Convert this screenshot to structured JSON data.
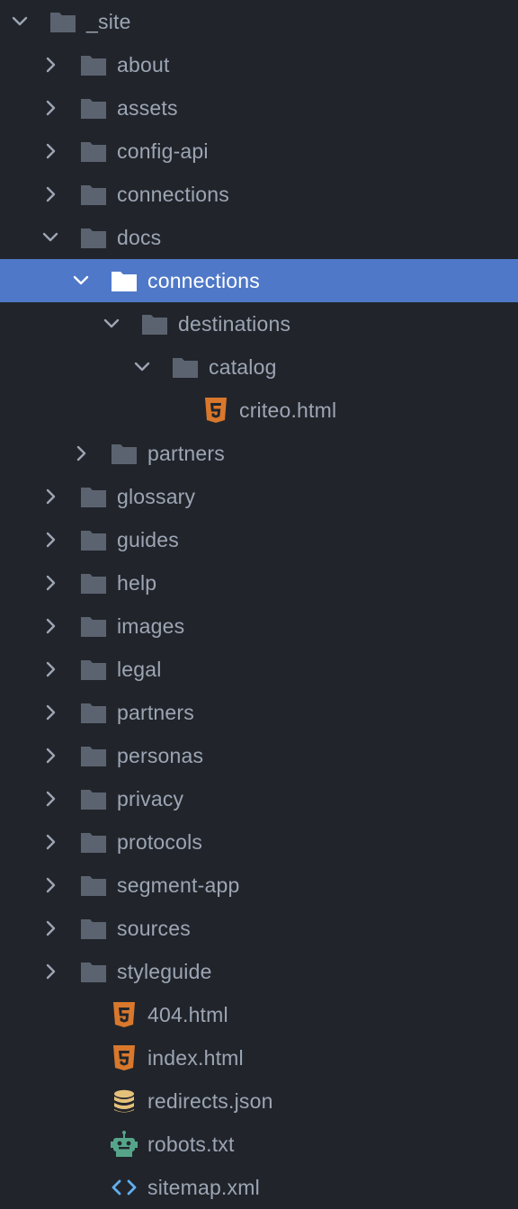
{
  "tree": {
    "rows": [
      {
        "label": "_site",
        "kind": "folder",
        "depth": 0,
        "expanded": true
      },
      {
        "label": "about",
        "kind": "folder",
        "depth": 1,
        "expanded": false
      },
      {
        "label": "assets",
        "kind": "folder",
        "depth": 1,
        "expanded": false
      },
      {
        "label": "config-api",
        "kind": "folder",
        "depth": 1,
        "expanded": false
      },
      {
        "label": "connections",
        "kind": "folder",
        "depth": 1,
        "expanded": false
      },
      {
        "label": "docs",
        "kind": "folder",
        "depth": 1,
        "expanded": true
      },
      {
        "label": "connections",
        "kind": "folder",
        "depth": 2,
        "expanded": true,
        "selected": true
      },
      {
        "label": "destinations",
        "kind": "folder",
        "depth": 3,
        "expanded": true
      },
      {
        "label": "catalog",
        "kind": "folder",
        "depth": 4,
        "expanded": true
      },
      {
        "label": "criteo.html",
        "kind": "html",
        "depth": 5
      },
      {
        "label": "partners",
        "kind": "folder",
        "depth": 2,
        "expanded": false
      },
      {
        "label": "glossary",
        "kind": "folder",
        "depth": 1,
        "expanded": false
      },
      {
        "label": "guides",
        "kind": "folder",
        "depth": 1,
        "expanded": false
      },
      {
        "label": "help",
        "kind": "folder",
        "depth": 1,
        "expanded": false
      },
      {
        "label": "images",
        "kind": "folder",
        "depth": 1,
        "expanded": false
      },
      {
        "label": "legal",
        "kind": "folder",
        "depth": 1,
        "expanded": false
      },
      {
        "label": "partners",
        "kind": "folder",
        "depth": 1,
        "expanded": false
      },
      {
        "label": "personas",
        "kind": "folder",
        "depth": 1,
        "expanded": false
      },
      {
        "label": "privacy",
        "kind": "folder",
        "depth": 1,
        "expanded": false
      },
      {
        "label": "protocols",
        "kind": "folder",
        "depth": 1,
        "expanded": false
      },
      {
        "label": "segment-app",
        "kind": "folder",
        "depth": 1,
        "expanded": false
      },
      {
        "label": "sources",
        "kind": "folder",
        "depth": 1,
        "expanded": false
      },
      {
        "label": "styleguide",
        "kind": "folder",
        "depth": 1,
        "expanded": false
      },
      {
        "label": "404.html",
        "kind": "html",
        "depth": 2
      },
      {
        "label": "index.html",
        "kind": "html",
        "depth": 2
      },
      {
        "label": "redirects.json",
        "kind": "json",
        "depth": 2
      },
      {
        "label": "robots.txt",
        "kind": "robot",
        "depth": 2
      },
      {
        "label": "sitemap.xml",
        "kind": "xml",
        "depth": 2
      }
    ]
  },
  "icons": {
    "folder": "folder-icon",
    "html": "html5-icon",
    "json": "database-icon",
    "robot": "robot-icon",
    "xml": "code-icon",
    "expanded": "chevron-down-icon",
    "collapsed": "chevron-right-icon"
  },
  "colors": {
    "background": "#21252b",
    "selection": "#4f78c8",
    "text": "#9da5b4",
    "text_selected": "#ffffff",
    "folder": "#5c6370",
    "folder_selected": "#ffffff",
    "chevron": "#9da5b4",
    "html": "#d9782c",
    "json": "#e5c07b",
    "robot": "#56a58a",
    "xml": "#61afef"
  }
}
